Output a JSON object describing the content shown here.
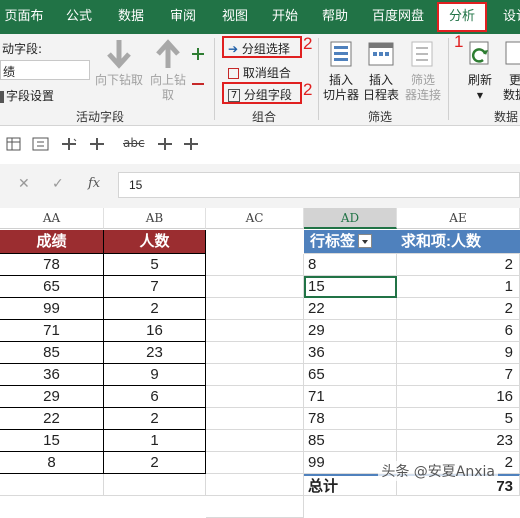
{
  "menu": {
    "items": [
      "页面布局",
      "公式",
      "数据",
      "审阅",
      "视图",
      "开始",
      "帮助",
      "百度网盘",
      "分析",
      "设计"
    ],
    "active": "分析"
  },
  "annotations": {
    "n1": "1",
    "n2a": "2",
    "n2b": "2"
  },
  "ribbon": {
    "active_field_label": "动字段:",
    "active_field_value": "绩",
    "field_settings": "字段设置",
    "drill_down": [
      "向下钻取",
      ""
    ],
    "drill_up": [
      "向上钻",
      "取"
    ],
    "group_active_field": "活动字段",
    "group_selection": "分组选择",
    "ungroup": "取消组合",
    "group_field": "分组字段",
    "group_group": "组合",
    "insert_slicer": [
      "插入",
      "切片器"
    ],
    "insert_timeline": [
      "插入",
      "日程表"
    ],
    "filter_connections": [
      "筛选",
      "器连接"
    ],
    "group_filter": "筛选",
    "refresh": "刷新",
    "change_source": [
      "更",
      "数据"
    ],
    "group_data": "数据"
  },
  "formula_bar": {
    "value": "15",
    "fx": "fx"
  },
  "columns": [
    "AA",
    "AB",
    "AC",
    "AD",
    "AE"
  ],
  "source_table": {
    "headers": [
      "成绩",
      "人数"
    ],
    "rows": [
      [
        "78",
        "5"
      ],
      [
        "65",
        "7"
      ],
      [
        "99",
        "2"
      ],
      [
        "71",
        "16"
      ],
      [
        "85",
        "23"
      ],
      [
        "36",
        "9"
      ],
      [
        "29",
        "6"
      ],
      [
        "22",
        "2"
      ],
      [
        "15",
        "1"
      ],
      [
        "8",
        "2"
      ]
    ]
  },
  "pivot": {
    "row_label": "行标签",
    "sum_label": "求和项:人数",
    "rows": [
      [
        "8",
        "2"
      ],
      [
        "15",
        "1"
      ],
      [
        "22",
        "2"
      ],
      [
        "29",
        "6"
      ],
      [
        "36",
        "9"
      ],
      [
        "65",
        "7"
      ],
      [
        "71",
        "16"
      ],
      [
        "78",
        "5"
      ],
      [
        "85",
        "23"
      ],
      [
        "99",
        "2"
      ]
    ],
    "total_label": "总计",
    "total_value": "73"
  },
  "watermark": "头条 @安夏Anxia",
  "colors": {
    "excel_green": "#217346",
    "header_red": "#9b2d30",
    "pivot_blue": "#4f81bd",
    "annotation_red": "#e02020"
  }
}
